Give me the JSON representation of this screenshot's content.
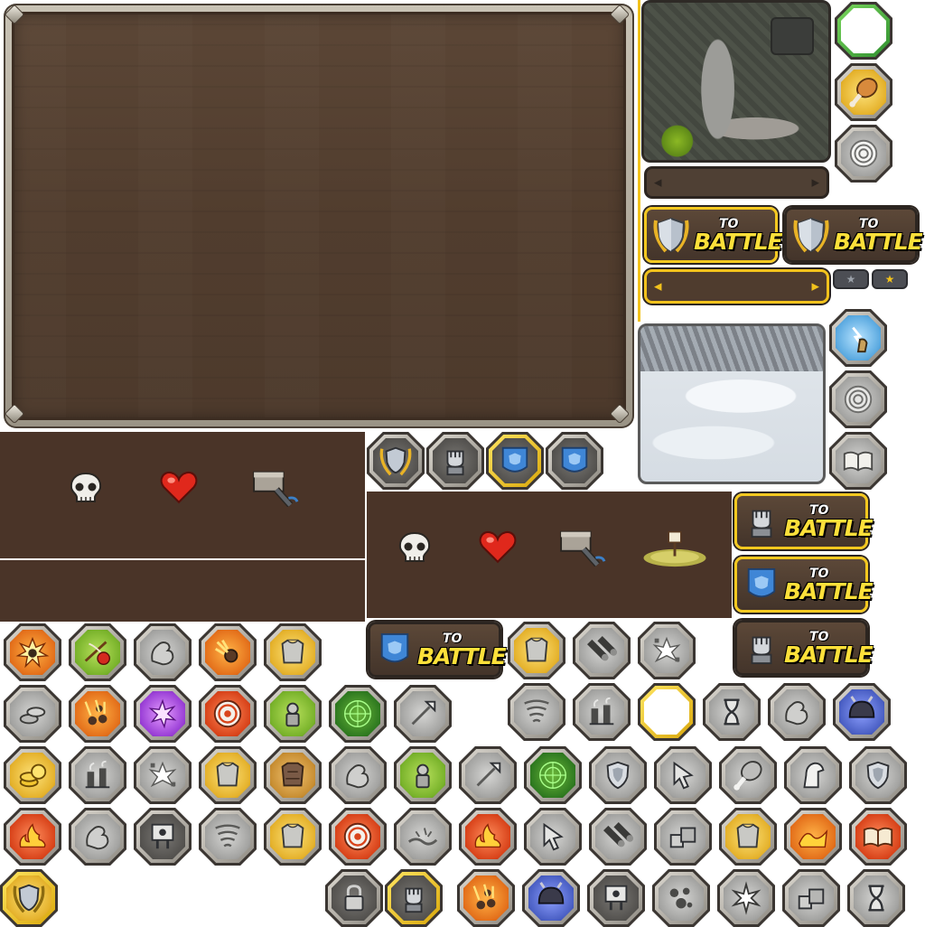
{
  "to_battle": {
    "to": "TO",
    "battle": "BATTLE"
  },
  "colors": {
    "accent_gold": "#f2c21c",
    "wood": "#513d2e",
    "panel_dark": "#4a3428",
    "button_dark": "#43342a",
    "battle_text": "#fde03a"
  },
  "top_row_icons": [
    "shield-laurel-icon",
    "fist-statue-icon",
    "blue-banner-icon",
    "blue-banner-icon"
  ],
  "side_column_icons": [
    "empty-slot-icon",
    "chicken-leg-icon",
    "target-icon",
    "lightning-hand-icon",
    "target-icon",
    "spellbook-icon"
  ],
  "star_pills": [
    {
      "icon": "star-icon",
      "state": "gray"
    },
    {
      "icon": "star-icon",
      "state": "gold"
    }
  ],
  "stat_panel_icons": [
    "skull-icon",
    "heart-icon",
    "hammer-icon"
  ],
  "stat_panel_2_icons": [
    "skull-icon",
    "heart-icon",
    "hammer-icon",
    "flag-on-ground-icon"
  ],
  "grid_rows": [
    [
      "explosion-icon",
      "crossbow-apple-icon",
      "muscle-arm-icon",
      "meteor-icon",
      "armor-icon"
    ],
    [
      "coins-stack-icon",
      "meteor-shower-icon",
      "purple-burst-icon",
      "target-icon",
      "soldier-icon",
      "radar-icon",
      "arrow-head-icon"
    ],
    [
      "gold-coins-icon",
      "chimney-icon",
      "shatter-icon",
      "armor-icon",
      "rock-armor-icon",
      "muscle-arm-icon",
      "soldier-icon",
      "arrow-head-icon",
      "radar-icon",
      "shield-icon",
      "cursor-icon",
      "chicken-leg-icon",
      "horse-icon",
      "shield-icon"
    ],
    [
      "fire-icon",
      "muscle-arm-icon",
      "banner-sign-icon",
      "tornado-icon",
      "armor-icon",
      "target-icon",
      "ground-crack-icon",
      "fire-icon",
      "cursor-icon",
      "cannon-icon",
      "crates-icon",
      "armor-icon",
      "fire-wave-icon",
      "spellbook-icon"
    ],
    [
      "shield-laurel-icon",
      "padlock-icon",
      "fist-statue-icon",
      "meteor-shower-icon",
      "helmet-icon",
      "banner-sign-icon",
      "rubble-icon",
      "burst-icon",
      "crates-icon",
      "hourglass-icon"
    ]
  ]
}
